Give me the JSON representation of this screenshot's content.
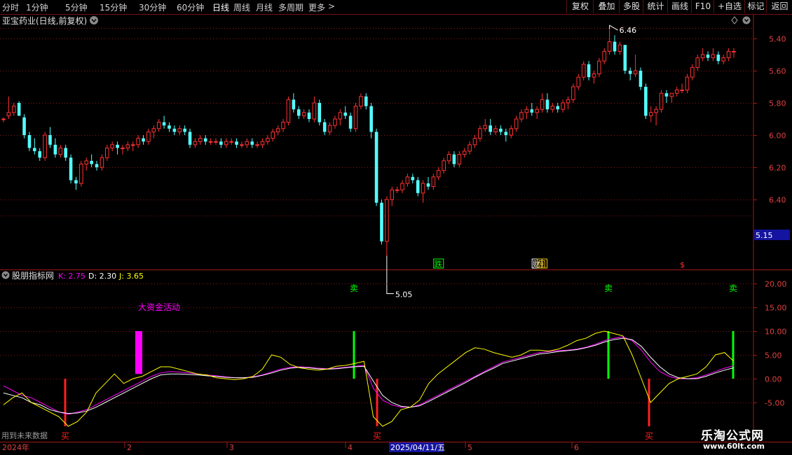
{
  "toolbar": {
    "periods": [
      "分时",
      "1分钟",
      "5分钟",
      "15分钟",
      "30分钟",
      "60分钟",
      "日线",
      "周线",
      "月线",
      "多周期",
      "更多"
    ],
    "active_period": "日线",
    "more_arrow": ">",
    "right_buttons": [
      "复权",
      "叠加",
      "多股",
      "统计",
      "画线",
      "F10",
      "+自选",
      "标记",
      "返回"
    ]
  },
  "price_panel": {
    "title": "亚宝药业(日线,前复权)",
    "y_ticks": [
      "6.40",
      "6.20",
      "6.00",
      "5.80",
      "5.60",
      "5.40"
    ],
    "current_price": "5.15",
    "high_label": "6.46",
    "low_label": "5.05",
    "markers": [
      {
        "text": "跌",
        "color": "#00ff00",
        "x_index": 84
      },
      {
        "text": "财",
        "color": "#ffffff",
        "x_index": 103
      },
      {
        "text": "回",
        "color": "#ffcc00",
        "x_index": 104
      },
      {
        "text": "$",
        "color": "#ff3030",
        "x_index": 131
      }
    ]
  },
  "indicator_panel": {
    "name": "股朋指标网",
    "k_label": "K: 2.75",
    "d_label": "D: 2.30",
    "j_label": "J: 3.65",
    "y_ticks": [
      "20.00",
      "15.00",
      "10.00",
      "5.00",
      "0.00",
      "-5.00"
    ],
    "annotation": "大资金活动",
    "sell_label": "卖",
    "buy_label": "买",
    "footer_note": "用到未来数据"
  },
  "date_axis": {
    "labels": [
      "2024年",
      "2",
      "3",
      "4",
      "2025/04/11/五",
      "5",
      "6"
    ]
  },
  "colors": {
    "up": "#ff3232",
    "down": "#54ffff",
    "k_line": "#ffffff",
    "d_line": "#ffff00",
    "j_line": "#ff00ff",
    "sell": "#00ff00",
    "buy": "#ff2020",
    "capital": "#ff00ff"
  },
  "watermark": {
    "title": "乐淘公式网",
    "url": "www.60lt.com"
  },
  "chart_data": [
    {
      "type": "candlestick",
      "title": "亚宝药业(日线,前复权)",
      "ylim": [
        5.0,
        6.55
      ],
      "y_ticks": [
        5.4,
        5.6,
        5.8,
        6.0,
        6.2,
        6.4
      ],
      "high": 6.46,
      "low": 5.05,
      "current_price": 5.15,
      "ohlc": [
        [
          5.9,
          5.91,
          5.88,
          5.9
        ],
        [
          5.92,
          6.04,
          5.9,
          5.94
        ],
        [
          5.94,
          6.0,
          5.92,
          5.98
        ],
        [
          6.0,
          6.01,
          5.92,
          5.92
        ],
        [
          5.91,
          5.93,
          5.78,
          5.8
        ],
        [
          5.8,
          5.82,
          5.7,
          5.72
        ],
        [
          5.72,
          5.78,
          5.68,
          5.7
        ],
        [
          5.7,
          5.72,
          5.64,
          5.66
        ],
        [
          5.66,
          5.82,
          5.64,
          5.8
        ],
        [
          5.8,
          5.85,
          5.72,
          5.74
        ],
        [
          5.74,
          5.78,
          5.66,
          5.68
        ],
        [
          5.68,
          5.74,
          5.66,
          5.72
        ],
        [
          5.72,
          5.74,
          5.64,
          5.66
        ],
        [
          5.66,
          5.68,
          5.5,
          5.52
        ],
        [
          5.52,
          5.54,
          5.46,
          5.5
        ],
        [
          5.5,
          5.64,
          5.48,
          5.62
        ],
        [
          5.62,
          5.66,
          5.58,
          5.64
        ],
        [
          5.64,
          5.68,
          5.6,
          5.62
        ],
        [
          5.62,
          5.64,
          5.58,
          5.6
        ],
        [
          5.6,
          5.68,
          5.58,
          5.66
        ],
        [
          5.66,
          5.74,
          5.64,
          5.72
        ],
        [
          5.72,
          5.76,
          5.7,
          5.74
        ],
        [
          5.74,
          5.76,
          5.68,
          5.72
        ],
        [
          5.72,
          5.74,
          5.68,
          5.72
        ],
        [
          5.72,
          5.76,
          5.7,
          5.74
        ],
        [
          5.74,
          5.76,
          5.7,
          5.74
        ],
        [
          5.74,
          5.8,
          5.72,
          5.78
        ],
        [
          5.78,
          5.8,
          5.74,
          5.76
        ],
        [
          5.76,
          5.84,
          5.74,
          5.82
        ],
        [
          5.82,
          5.86,
          5.78,
          5.84
        ],
        [
          5.84,
          5.9,
          5.82,
          5.88
        ],
        [
          5.88,
          5.92,
          5.84,
          5.86
        ],
        [
          5.86,
          5.88,
          5.82,
          5.84
        ],
        [
          5.84,
          5.86,
          5.8,
          5.82
        ],
        [
          5.82,
          5.86,
          5.8,
          5.84
        ],
        [
          5.84,
          5.86,
          5.8,
          5.82
        ],
        [
          5.82,
          5.84,
          5.72,
          5.74
        ],
        [
          5.74,
          5.78,
          5.72,
          5.76
        ],
        [
          5.76,
          5.8,
          5.74,
          5.78
        ],
        [
          5.78,
          5.8,
          5.74,
          5.76
        ],
        [
          5.76,
          5.78,
          5.74,
          5.76
        ],
        [
          5.76,
          5.78,
          5.74,
          5.76
        ],
        [
          5.76,
          5.78,
          5.72,
          5.74
        ],
        [
          5.74,
          5.78,
          5.72,
          5.76
        ],
        [
          5.76,
          5.78,
          5.74,
          5.76
        ],
        [
          5.76,
          5.78,
          5.72,
          5.74
        ],
        [
          5.74,
          5.76,
          5.72,
          5.74
        ],
        [
          5.74,
          5.78,
          5.72,
          5.76
        ],
        [
          5.76,
          5.78,
          5.72,
          5.74
        ],
        [
          5.74,
          5.76,
          5.72,
          5.74
        ],
        [
          5.74,
          5.78,
          5.72,
          5.76
        ],
        [
          5.76,
          5.8,
          5.74,
          5.78
        ],
        [
          5.78,
          5.84,
          5.76,
          5.82
        ],
        [
          5.82,
          5.86,
          5.8,
          5.84
        ],
        [
          5.84,
          5.9,
          5.82,
          5.88
        ],
        [
          5.88,
          6.04,
          5.86,
          6.02
        ],
        [
          6.02,
          6.06,
          5.94,
          5.96
        ],
        [
          5.96,
          5.98,
          5.9,
          5.92
        ],
        [
          5.92,
          5.96,
          5.9,
          5.94
        ],
        [
          5.94,
          5.96,
          5.88,
          5.9
        ],
        [
          5.9,
          6.04,
          5.88,
          6.0
        ],
        [
          6.0,
          6.02,
          5.86,
          5.88
        ],
        [
          5.88,
          5.9,
          5.8,
          5.82
        ],
        [
          5.82,
          5.88,
          5.8,
          5.86
        ],
        [
          5.86,
          5.92,
          5.84,
          5.9
        ],
        [
          5.9,
          5.96,
          5.86,
          5.94
        ],
        [
          5.94,
          5.98,
          5.9,
          5.92
        ],
        [
          5.92,
          5.94,
          5.82,
          5.84
        ],
        [
          5.84,
          6.0,
          5.82,
          5.98
        ],
        [
          5.98,
          6.06,
          5.96,
          6.04
        ],
        [
          6.04,
          6.06,
          5.96,
          5.98
        ],
        [
          5.98,
          6.0,
          5.78,
          5.82
        ],
        [
          5.82,
          5.84,
          5.36,
          5.38
        ],
        [
          5.38,
          5.4,
          5.12,
          5.14
        ],
        [
          5.14,
          5.42,
          5.05,
          5.4
        ],
        [
          5.4,
          5.48,
          5.36,
          5.46
        ],
        [
          5.46,
          5.48,
          5.44,
          5.46
        ],
        [
          5.46,
          5.52,
          5.44,
          5.5
        ],
        [
          5.5,
          5.56,
          5.48,
          5.54
        ],
        [
          5.54,
          5.56,
          5.5,
          5.52
        ],
        [
          5.52,
          5.54,
          5.42,
          5.44
        ],
        [
          5.44,
          5.52,
          5.38,
          5.5
        ],
        [
          5.5,
          5.54,
          5.46,
          5.48
        ],
        [
          5.48,
          5.56,
          5.46,
          5.54
        ],
        [
          5.54,
          5.6,
          5.52,
          5.58
        ],
        [
          5.58,
          5.66,
          5.56,
          5.64
        ],
        [
          5.64,
          5.7,
          5.62,
          5.68
        ],
        [
          5.68,
          5.7,
          5.6,
          5.62
        ],
        [
          5.62,
          5.7,
          5.6,
          5.68
        ],
        [
          5.68,
          5.72,
          5.66,
          5.7
        ],
        [
          5.7,
          5.76,
          5.68,
          5.74
        ],
        [
          5.74,
          5.8,
          5.72,
          5.78
        ],
        [
          5.78,
          5.86,
          5.76,
          5.84
        ],
        [
          5.84,
          5.9,
          5.82,
          5.86
        ],
        [
          5.86,
          5.9,
          5.8,
          5.82
        ],
        [
          5.82,
          5.86,
          5.8,
          5.84
        ],
        [
          5.84,
          5.86,
          5.8,
          5.82
        ],
        [
          5.82,
          5.84,
          5.76,
          5.8
        ],
        [
          5.8,
          5.86,
          5.78,
          5.84
        ],
        [
          5.84,
          5.92,
          5.82,
          5.9
        ],
        [
          5.9,
          5.96,
          5.88,
          5.94
        ],
        [
          5.94,
          5.98,
          5.9,
          5.96
        ],
        [
          5.96,
          6.0,
          5.92,
          5.94
        ],
        [
          5.94,
          5.98,
          5.9,
          5.96
        ],
        [
          5.96,
          6.06,
          5.94,
          6.02
        ],
        [
          6.02,
          6.06,
          5.94,
          5.96
        ],
        [
          5.96,
          6.0,
          5.94,
          5.98
        ],
        [
          5.98,
          6.0,
          5.94,
          5.96
        ],
        [
          5.96,
          6.02,
          5.94,
          6.0
        ],
        [
          6.0,
          6.04,
          5.96,
          6.02
        ],
        [
          6.02,
          6.12,
          6.0,
          6.1
        ],
        [
          6.1,
          6.18,
          6.08,
          6.16
        ],
        [
          6.16,
          6.26,
          6.14,
          6.24
        ],
        [
          6.24,
          6.26,
          6.14,
          6.16
        ],
        [
          6.16,
          6.2,
          6.12,
          6.18
        ],
        [
          6.18,
          6.28,
          6.16,
          6.26
        ],
        [
          6.26,
          6.34,
          6.24,
          6.32
        ],
        [
          6.32,
          6.46,
          6.3,
          6.38
        ],
        [
          6.38,
          6.42,
          6.3,
          6.32
        ],
        [
          6.32,
          6.38,
          6.3,
          6.36
        ],
        [
          6.36,
          6.36,
          6.18,
          6.2
        ],
        [
          6.2,
          6.22,
          6.14,
          6.18
        ],
        [
          6.18,
          6.3,
          6.16,
          6.2
        ],
        [
          6.2,
          6.22,
          6.08,
          6.1
        ],
        [
          6.1,
          6.12,
          5.9,
          5.92
        ],
        [
          5.92,
          5.98,
          5.88,
          5.94
        ],
        [
          5.94,
          5.98,
          5.86,
          5.96
        ],
        [
          5.96,
          6.08,
          5.94,
          6.06
        ],
        [
          6.06,
          6.08,
          6.0,
          6.04
        ],
        [
          6.04,
          6.06,
          6.0,
          6.06
        ],
        [
          6.06,
          6.1,
          6.04,
          6.08
        ],
        [
          6.08,
          6.12,
          6.06,
          6.08
        ],
        [
          6.08,
          6.18,
          6.06,
          6.16
        ],
        [
          6.16,
          6.24,
          6.14,
          6.22
        ],
        [
          6.22,
          6.3,
          6.2,
          6.28
        ],
        [
          6.28,
          6.34,
          6.26,
          6.3
        ],
        [
          6.3,
          6.32,
          6.26,
          6.28
        ],
        [
          6.28,
          6.34,
          6.26,
          6.3
        ],
        [
          6.3,
          6.32,
          6.24,
          6.26
        ],
        [
          6.26,
          6.3,
          6.24,
          6.28
        ],
        [
          6.28,
          6.34,
          6.26,
          6.32
        ],
        [
          6.32,
          6.34,
          6.28,
          6.32
        ]
      ]
    },
    {
      "type": "line",
      "title": "股朋指标网",
      "ylim": [
        -10,
        22
      ],
      "y_ticks": [
        -5,
        0,
        5,
        10,
        15,
        20
      ],
      "series": [
        {
          "name": "K",
          "values": [
            -1.5,
            -2.5,
            -3.5,
            -4,
            -5,
            -6,
            -7,
            -7.5,
            -7,
            -6.5,
            -5.5,
            -4.5,
            -3.5,
            -2.5,
            -1.5,
            -0.5,
            0.5,
            1.2,
            1.5,
            1.4,
            1.2,
            1,
            0.8,
            0.6,
            0.4,
            0.2,
            0.2,
            0.4,
            0.8,
            1.4,
            2,
            2.4,
            2.5,
            2.4,
            2.2,
            2.1,
            2.2,
            2.4,
            2.6,
            2.8,
            -2,
            -4.5,
            -5.5,
            -6,
            -6,
            -5.5,
            -4.5,
            -3.5,
            -2.5,
            -1.5,
            -0.5,
            0.5,
            1.5,
            2.5,
            3.5,
            4,
            4.5,
            5,
            5.5,
            5.7,
            5.9,
            6,
            6.2,
            6.6,
            7.2,
            8,
            8.5,
            8.8,
            8,
            6,
            3.5,
            1.5,
            0.5,
            0,
            0,
            0.2,
            0.8,
            1.5,
            2.2,
            2.75
          ]
        },
        {
          "name": "D",
          "values": [
            -3,
            -3.5,
            -4,
            -5,
            -5.5,
            -6.5,
            -7,
            -7.3,
            -7.2,
            -6.8,
            -6,
            -5,
            -4,
            -3,
            -2,
            -1,
            0,
            0.8,
            1,
            1,
            0.9,
            0.8,
            0.6,
            0.5,
            0.3,
            0.2,
            0.2,
            0.3,
            0.7,
            1.2,
            1.8,
            2.2,
            2.4,
            2.3,
            2.1,
            2,
            2.1,
            2.3,
            2.5,
            2.6,
            -0.5,
            -3.5,
            -5,
            -5.8,
            -6,
            -5.7,
            -4.8,
            -3.8,
            -2.8,
            -1.8,
            -0.8,
            0.3,
            1.3,
            2.2,
            3.2,
            3.7,
            4.2,
            4.7,
            5.2,
            5.4,
            5.7,
            5.9,
            6.1,
            6.5,
            7,
            7.7,
            8.2,
            8.5,
            8.2,
            6.8,
            4.5,
            2.5,
            1,
            0.2,
            0,
            0,
            0.5,
            1.2,
            1.8,
            2.3
          ]
        },
        {
          "name": "J",
          "values": [
            -5.5,
            -4,
            -3,
            -5,
            -6,
            -7,
            -8,
            -10,
            -9,
            -7,
            -3,
            -1,
            1,
            -1,
            0,
            0.5,
            1.5,
            2.5,
            2.5,
            2,
            1.5,
            1,
            0.8,
            0.2,
            0,
            -0.2,
            0,
            0.5,
            2,
            5,
            4.5,
            3,
            2.3,
            2,
            1.8,
            2,
            2.6,
            2.8,
            3.2,
            3.65,
            -8,
            -10,
            -9,
            -6.5,
            -6,
            -4.5,
            -1,
            1,
            2.5,
            4,
            5.5,
            6.5,
            6.2,
            5.5,
            5,
            4.5,
            5,
            6,
            6,
            5.8,
            6.2,
            7,
            8,
            8.5,
            9.5,
            10,
            9.5,
            9,
            5,
            0,
            -5,
            -3,
            -1,
            0,
            0.5,
            1,
            2.5,
            5,
            5.5,
            3.65
          ]
        }
      ]
    }
  ]
}
